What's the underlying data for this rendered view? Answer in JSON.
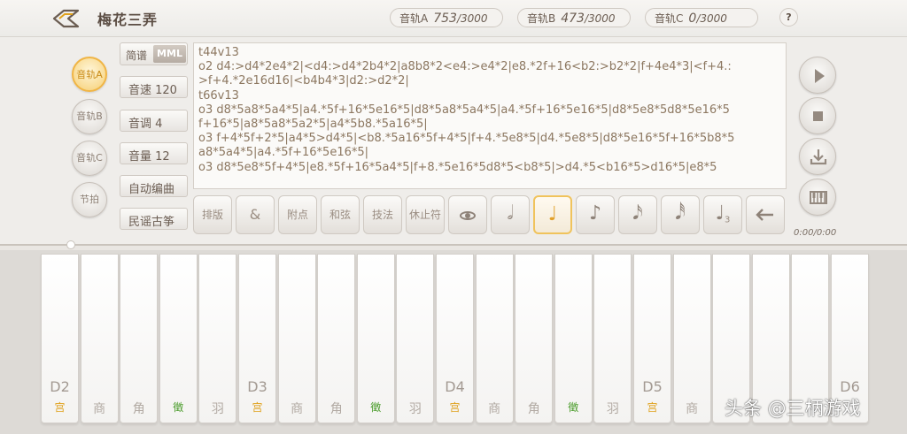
{
  "header": {
    "song_title": "梅花三弄",
    "tracks": [
      {
        "label": "音轨A",
        "used": "753",
        "max": "/3000"
      },
      {
        "label": "音轨B",
        "used": "473",
        "max": "/3000"
      },
      {
        "label": "音轨C",
        "used": "0",
        "max": "/3000"
      }
    ],
    "help": "?"
  },
  "track_select": {
    "items": [
      {
        "label": "音轨A",
        "active": true
      },
      {
        "label": "音轨B",
        "active": false
      },
      {
        "label": "音轨C",
        "active": false
      },
      {
        "label": "节拍",
        "active": false
      }
    ]
  },
  "mode": {
    "simple": "简谱",
    "mml": "MML",
    "selected": "MML"
  },
  "settings": {
    "tempo": "音速 120",
    "key": "音调 4",
    "volume": "音量 12",
    "auto_compose": "自动编曲",
    "instrument": "民谣古筝"
  },
  "editor": {
    "lines": [
      "t44v13",
      "o2 d4:>d4*2e4*2|<d4:>d4*2b4*2|a8b8*2<e4:>e4*2|e8.*2f+16<b2:>b2*2|f+4e4*3|<f+4.:",
      ">f+4.*2e16d16|<b4b4*3|d2:>d2*2|",
      "t66v13",
      "o3 d8*5a8*5a4*5|a4.*5f+16*5e16*5|d8*5a8*5a4*5|a4.*5f+16*5e16*5|d8*5e8*5d8*5e16*5",
      "f+16*5|a8*5a8*5a2*5|a4*5b8.*5a16*5|",
      "o3 f+4*5f+2*5|a4*5>d4*5|<b8.*5a16*5f+4*5|f+4.*5e8*5|d4.*5e8*5|d8*5e16*5f+16*5b8*5",
      "a8*5a4*5|a4.*5f+16*5e16*5|",
      "o3 d8*5e8*5f+4*5|e8.*5f+16*5a4*5|f+8.*5e16*5d8*5<b8*5|>d4.*5<b16*5>d16*5|e8*5"
    ]
  },
  "toolbar": {
    "layout": "排版",
    "tie": "&",
    "dot": "附点",
    "chord": "和弦",
    "technique": "技法",
    "rest": "休止符",
    "triplet_sub": "3"
  },
  "playback": {
    "time": "0/00:0/00"
  },
  "time_display": "0:00/0:00",
  "keyboard": {
    "keys": [
      {
        "note": "D2",
        "degree": "宫",
        "kind": "gong"
      },
      {
        "note": "",
        "degree": "商",
        "kind": "plain"
      },
      {
        "note": "",
        "degree": "角",
        "kind": "plain"
      },
      {
        "note": "",
        "degree": "徵",
        "kind": "zhi"
      },
      {
        "note": "",
        "degree": "羽",
        "kind": "plain"
      },
      {
        "note": "D3",
        "degree": "宫",
        "kind": "gong"
      },
      {
        "note": "",
        "degree": "商",
        "kind": "plain"
      },
      {
        "note": "",
        "degree": "角",
        "kind": "plain"
      },
      {
        "note": "",
        "degree": "徵",
        "kind": "zhi"
      },
      {
        "note": "",
        "degree": "羽",
        "kind": "plain"
      },
      {
        "note": "D4",
        "degree": "宫",
        "kind": "gong"
      },
      {
        "note": "",
        "degree": "商",
        "kind": "plain"
      },
      {
        "note": "",
        "degree": "角",
        "kind": "plain"
      },
      {
        "note": "",
        "degree": "徵",
        "kind": "zhi"
      },
      {
        "note": "",
        "degree": "羽",
        "kind": "plain"
      },
      {
        "note": "D5",
        "degree": "宫",
        "kind": "gong"
      },
      {
        "note": "",
        "degree": "商",
        "kind": "plain"
      },
      {
        "note": "",
        "degree": "",
        "kind": "plain"
      },
      {
        "note": "",
        "degree": "",
        "kind": "plain"
      },
      {
        "note": "",
        "degree": "",
        "kind": "plain"
      },
      {
        "note": "D6",
        "degree": "",
        "kind": "plain"
      }
    ]
  },
  "watermark": "头条 @三柄游戏",
  "colors": {
    "accent": "#f0b545",
    "gong": "#e0a21e",
    "zhi": "#4a9c2b",
    "editor_text": "#8c7760"
  }
}
